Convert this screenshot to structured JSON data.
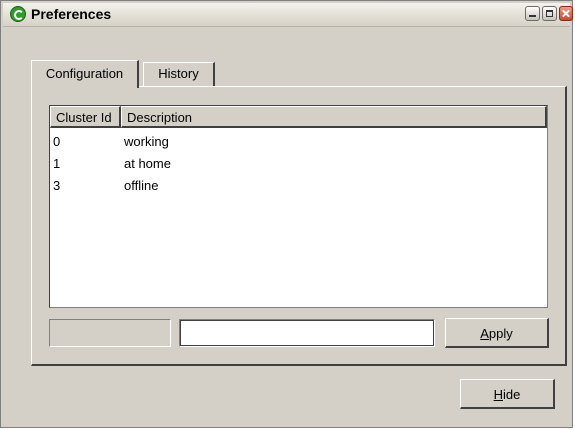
{
  "window": {
    "title": "Preferences"
  },
  "tabs": [
    {
      "label": "Configuration",
      "active": true
    },
    {
      "label": "History",
      "active": false
    }
  ],
  "table": {
    "columns": [
      "Cluster Id",
      "Description"
    ],
    "rows": [
      {
        "id": "0",
        "description": "working"
      },
      {
        "id": "1",
        "description": "at home"
      },
      {
        "id": "3",
        "description": "offline"
      }
    ]
  },
  "form": {
    "left_field_value": "",
    "input_value": ""
  },
  "buttons": {
    "apply": {
      "mnemonic": "A",
      "rest": "pply"
    },
    "hide": {
      "mnemonic": "H",
      "rest": "ide"
    }
  }
}
